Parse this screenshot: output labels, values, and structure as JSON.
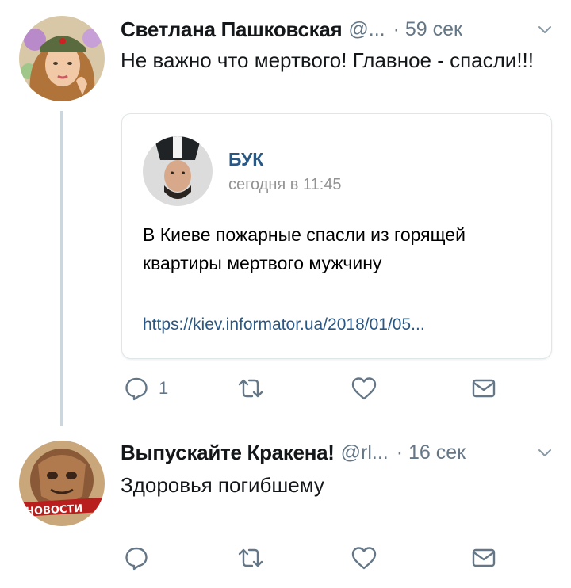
{
  "tweets": [
    {
      "display_name": "Светлана Пашковская",
      "handle": "@...",
      "time": "· 59 сек",
      "text": "Не важно что мертвого! Главное - спасли!!!",
      "avatar_icon": "woman-portrait-avatar",
      "quoted_card": {
        "author": "БУК",
        "date": "сегодня в 11:45",
        "text": "В Киеве пожарные спасли из горящей квартиры мертвого мужчину",
        "link": "https://kiev.informator.ua/2018/01/05..."
      },
      "actions": {
        "reply_count": "1"
      }
    },
    {
      "display_name": "Выпускайте Кракена!",
      "handle": "@rl...",
      "time": "· 16 сек",
      "text": "Здоровья погибшему",
      "avatar_icon": "novosti-logo-avatar",
      "avatar_label": "НОВОСТИ",
      "actions": {
        "reply_count": ""
      }
    }
  ],
  "colors": {
    "text": "#14171a",
    "secondary": "#657786",
    "thread_line": "#ccd6dd",
    "vk_link": "#2a5885"
  }
}
